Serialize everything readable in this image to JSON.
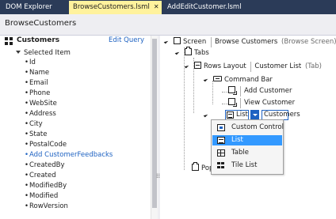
{
  "tabs": [
    {
      "label": "DOM Explorer",
      "active": false
    },
    {
      "label": "BrowseCustomers.lsml",
      "active": true
    },
    {
      "label": "AddEditCustomer.lsml",
      "active": false
    }
  ],
  "tab_close_glyph": "✕",
  "header": {
    "title": "BrowseCustomers"
  },
  "left_pane": {
    "entity": "Customers",
    "edit_query": "Edit Query",
    "selected_item": "Selected Item",
    "fields": [
      {
        "label": "Id",
        "link": false
      },
      {
        "label": "Name",
        "link": false
      },
      {
        "label": "Email",
        "link": false
      },
      {
        "label": "Phone",
        "link": false
      },
      {
        "label": "WebSite",
        "link": false
      },
      {
        "label": "Address",
        "link": false
      },
      {
        "label": "City",
        "link": false
      },
      {
        "label": "State",
        "link": false
      },
      {
        "label": "PostalCode",
        "link": false
      },
      {
        "label": "Add CustomerFeedbacks",
        "link": true
      },
      {
        "label": "CreatedBy",
        "link": false
      },
      {
        "label": "Created",
        "link": false
      },
      {
        "label": "ModifiedBy",
        "link": false
      },
      {
        "label": "Modified",
        "link": false
      },
      {
        "label": "RowVersion",
        "link": false
      }
    ],
    "bullet": "•"
  },
  "tree": {
    "screen": {
      "kind": "Screen",
      "name": "Browse Customers",
      "detail": "(Browse Screen)"
    },
    "tabs": "Tabs",
    "rows_layout": {
      "kind": "Rows Layout",
      "name": "Customer List",
      "detail": "(Tab)"
    },
    "command_bar": "Command Bar",
    "add_customer": "Add Customer",
    "view_customer": "View Customer",
    "list": {
      "kind": "List",
      "name": "Customers"
    },
    "pop_truncated": "Pop"
  },
  "dropdown": {
    "items": [
      {
        "label": "Custom Control",
        "icon": "custom-control-icon",
        "selected": false
      },
      {
        "label": "List",
        "icon": "list-icon",
        "selected": true
      },
      {
        "label": "Table",
        "icon": "table-icon",
        "selected": false
      },
      {
        "label": "Tile List",
        "icon": "tile-list-icon",
        "selected": false
      }
    ]
  },
  "colors": {
    "tab_strip": "#2b3b58",
    "active_tab": "#fff29d",
    "link": "#1e62c2",
    "selection": "#3399ff"
  }
}
